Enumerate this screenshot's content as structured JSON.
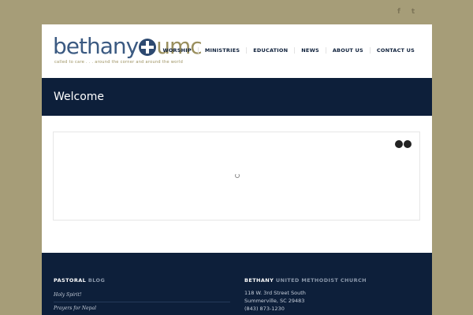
{
  "social": {
    "facebook_glyph": "f",
    "twitter_glyph": "t"
  },
  "logo": {
    "part1": "bethany",
    "part2": "umc",
    "tagline": "called to care . . . around the corner and around the world"
  },
  "nav": {
    "items": [
      "WORSHIP",
      "MINISTRIES",
      "EDUCATION",
      "NEWS",
      "ABOUT US",
      "CONTACT US"
    ]
  },
  "banner": {
    "title": "Welcome"
  },
  "footer": {
    "blog": {
      "head_strong": "PASTORAL",
      "head_light": "BLOG",
      "links": [
        "Holy Spirit!",
        "Prayers for Nepal"
      ]
    },
    "church": {
      "head_strong": "BETHANY",
      "head_light": "UNITED METHODIST CHURCH",
      "address": [
        "118 W. 3rd Street South",
        "Summerville, SC 29483",
        "(843) 873-1230"
      ]
    }
  },
  "colors": {
    "page_bg": "#a69d78",
    "navy": "#0d1f3a",
    "logo_blue": "#3b5a82",
    "logo_gold": "#9a8f5e"
  }
}
